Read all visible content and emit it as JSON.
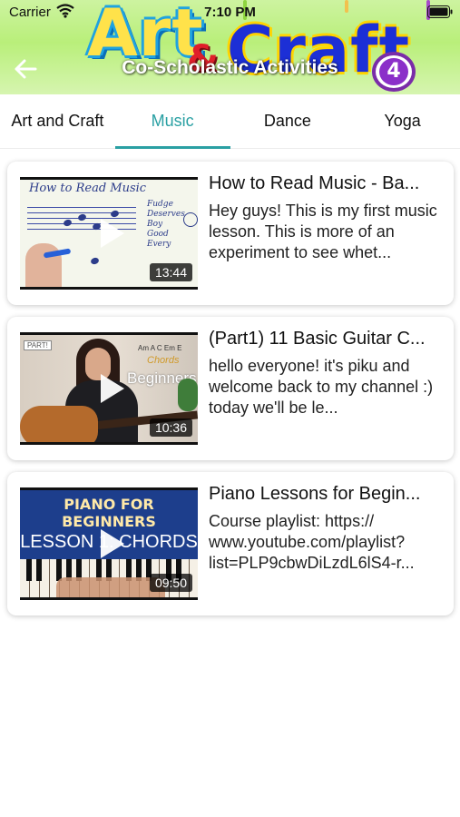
{
  "status_bar": {
    "carrier": "Carrier",
    "time": "7:10 PM"
  },
  "header": {
    "banner_word1": "Art",
    "banner_amp": "&",
    "banner_word2": "Craft",
    "title": "Co-Scholastic Activities",
    "badge": "4",
    "back_icon": "back-arrow-icon"
  },
  "tabs": [
    {
      "label": "Art and Craft",
      "active": false
    },
    {
      "label": "Music",
      "active": true
    },
    {
      "label": "Dance",
      "active": false
    },
    {
      "label": "Yoga",
      "active": false
    }
  ],
  "colors": {
    "accent": "#2aa0a3",
    "header_bg": "#b9ef7a",
    "text": "#111111"
  },
  "videos": [
    {
      "title": "How to Read Music - Ba...",
      "description": "Hey guys! This is my first music lesson. This is more of an experiment to see whet...",
      "duration": "13:44",
      "thumb": {
        "heading": "How to Read Music",
        "words": [
          "Fudge",
          "Deserves",
          "Boy",
          "Good",
          "Every"
        ]
      }
    },
    {
      "title": "(Part1) 11 Basic Guitar C...",
      "description": "hello everyone! it's piku and welcome back to my channel :) today we'll be le...",
      "duration": "10:36",
      "thumb": {
        "tag": "PART!",
        "chord_names": "Am  A  C  Em  E",
        "chords": "Chords",
        "beginners": "Beginners"
      }
    },
    {
      "title": "Piano Lessons for Begin...",
      "description": "Course playlist: https:// www.youtube.com/playlist? list=PLP9cbwDiLzdL6lS4-r...",
      "duration": "09:50",
      "thumb": {
        "line1": "PIANO FOR",
        "line2": "BEGINNERS",
        "line3": "LESSON 1: CHORDS"
      }
    }
  ]
}
